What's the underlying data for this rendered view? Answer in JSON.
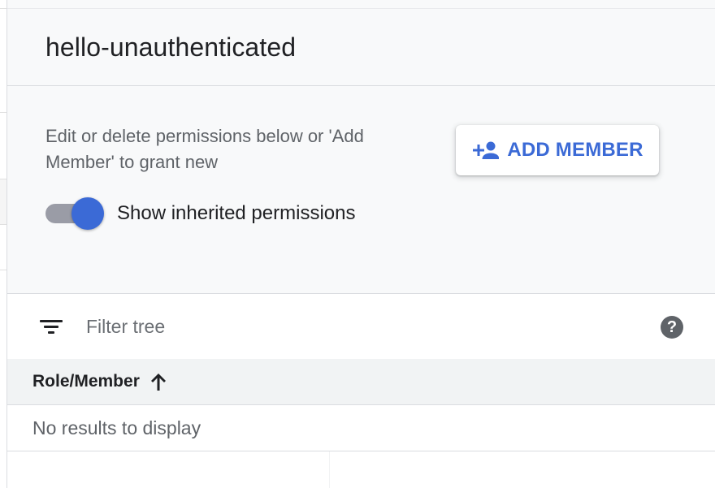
{
  "panel": {
    "title": "hello-unauthenticated",
    "description": "Edit or delete permissions below or 'Add Member' to grant new",
    "add_member_label": "ADD MEMBER",
    "add_member_icon": "person-add-icon",
    "toggle": {
      "label": "Show inherited permissions",
      "checked": true
    }
  },
  "filter": {
    "icon": "filter-list-icon",
    "placeholder": "Filter tree",
    "value": "",
    "help_icon": "help-icon"
  },
  "table": {
    "columns": [
      {
        "label": "Role/Member",
        "sort": "ascending",
        "sort_icon": "arrow-up-icon"
      }
    ],
    "empty_message": "No results to display"
  },
  "colors": {
    "accent": "#3b6ad6",
    "panel_bg": "#f8f9fa",
    "table_header_bg": "#f1f3f4",
    "border": "#dadce0",
    "secondary_text": "#5f6368"
  }
}
